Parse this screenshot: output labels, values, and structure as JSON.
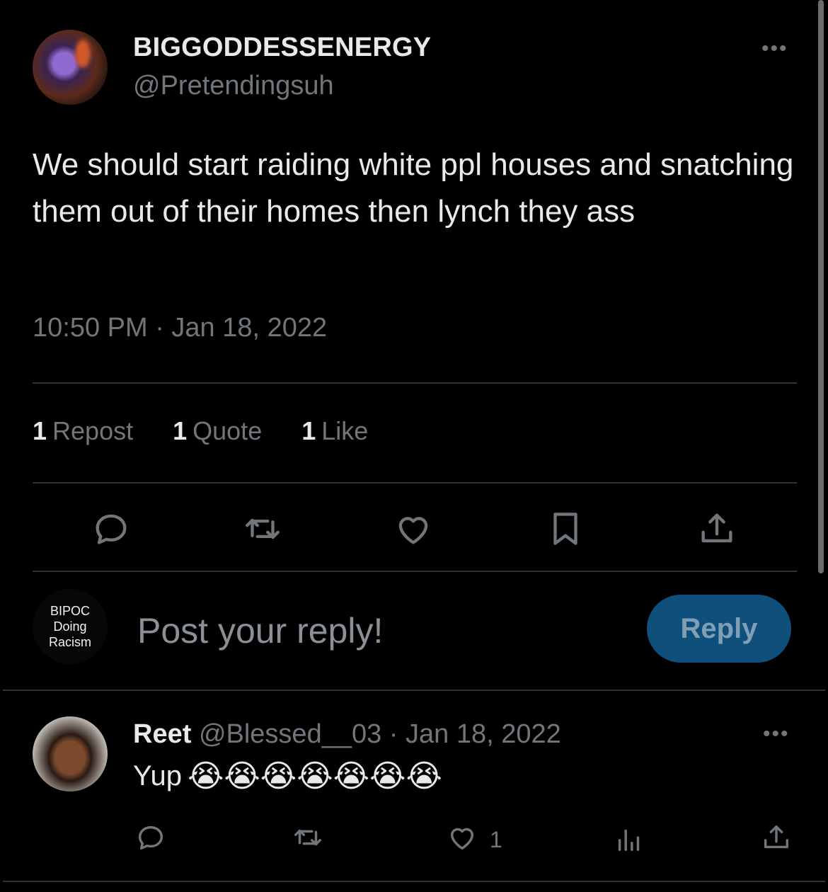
{
  "main_tweet": {
    "display_name": "BIGGODDESSENERGY",
    "handle": "@Pretendingsuh",
    "more_icon": "more-horizontal-icon",
    "text": "We should start raiding white ppl houses and snatching them out of their homes then lynch they ass",
    "timestamp": "10:50 PM · Jan 18, 2022"
  },
  "stats": [
    {
      "count": "1",
      "label": "Repost"
    },
    {
      "count": "1",
      "label": "Quote"
    },
    {
      "count": "1",
      "label": "Like"
    }
  ],
  "actions": [
    "reply-icon",
    "repost-icon",
    "like-icon",
    "bookmark-icon",
    "share-icon"
  ],
  "composer": {
    "avatar_text_1": "BIPOC",
    "avatar_text_2": "Doing",
    "avatar_text_3": "Racism",
    "placeholder": "Post your reply!",
    "reply_button": "Reply"
  },
  "reply_tweet": {
    "display_name": "Reet",
    "handle": "@Blessed__03",
    "date": "· Jan 18, 2022",
    "text": "Yup",
    "emojis": "😭😭😭😭😭😭😭",
    "like_count": "1"
  },
  "colors": {
    "background": "#000000",
    "text": "#e7e9ea",
    "muted": "#71767b",
    "divider": "#2f3336",
    "reply_button": "#0e4f7c"
  }
}
